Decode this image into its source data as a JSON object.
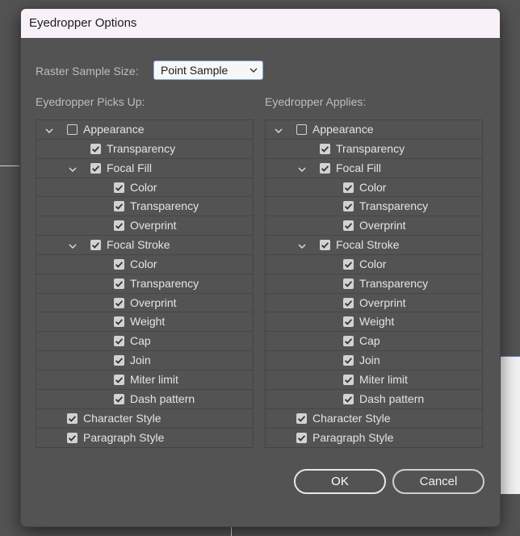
{
  "dialog": {
    "title": "Eyedropper Options",
    "raster_sample_label": "Raster Sample Size:",
    "raster_sample_value": "Point Sample",
    "picks_up_label": "Eyedropper Picks Up:",
    "applies_label": "Eyedropper Applies:",
    "ok_label": "OK",
    "cancel_label": "Cancel"
  },
  "tree_items": [
    {
      "label": "Appearance",
      "level": 0,
      "expander": true,
      "checked": false,
      "name": "appearance"
    },
    {
      "label": "Transparency",
      "level": 1,
      "expander": false,
      "checked": true,
      "name": "appearance-transparency"
    },
    {
      "label": "Focal Fill",
      "level": 1,
      "expander": true,
      "checked": true,
      "name": "focal-fill"
    },
    {
      "label": "Color",
      "level": 2,
      "expander": false,
      "checked": true,
      "name": "fill-color"
    },
    {
      "label": "Transparency",
      "level": 2,
      "expander": false,
      "checked": true,
      "name": "fill-transparency"
    },
    {
      "label": "Overprint",
      "level": 2,
      "expander": false,
      "checked": true,
      "name": "fill-overprint"
    },
    {
      "label": "Focal Stroke",
      "level": 1,
      "expander": true,
      "checked": true,
      "name": "focal-stroke"
    },
    {
      "label": "Color",
      "level": 2,
      "expander": false,
      "checked": true,
      "name": "stroke-color"
    },
    {
      "label": "Transparency",
      "level": 2,
      "expander": false,
      "checked": true,
      "name": "stroke-transparency"
    },
    {
      "label": "Overprint",
      "level": 2,
      "expander": false,
      "checked": true,
      "name": "stroke-overprint"
    },
    {
      "label": "Weight",
      "level": 2,
      "expander": false,
      "checked": true,
      "name": "stroke-weight"
    },
    {
      "label": "Cap",
      "level": 2,
      "expander": false,
      "checked": true,
      "name": "stroke-cap"
    },
    {
      "label": "Join",
      "level": 2,
      "expander": false,
      "checked": true,
      "name": "stroke-join"
    },
    {
      "label": "Miter limit",
      "level": 2,
      "expander": false,
      "checked": true,
      "name": "stroke-miter-limit"
    },
    {
      "label": "Dash pattern",
      "level": 2,
      "expander": false,
      "checked": true,
      "name": "stroke-dash-pattern"
    },
    {
      "label": "Character Style",
      "level": 0,
      "expander": false,
      "checked": true,
      "name": "character-style"
    },
    {
      "label": "Paragraph Style",
      "level": 0,
      "expander": false,
      "checked": true,
      "name": "paragraph-style"
    }
  ],
  "icons": {
    "expander": "chevron-down-icon",
    "checkbox_checked": "checkmark-icon",
    "select": "chevron-down-icon"
  },
  "colors": {
    "dialog_bg": "#535353",
    "titlebar_bg": "#f8f2f8",
    "select_focus_border": "#8ab0e6"
  }
}
